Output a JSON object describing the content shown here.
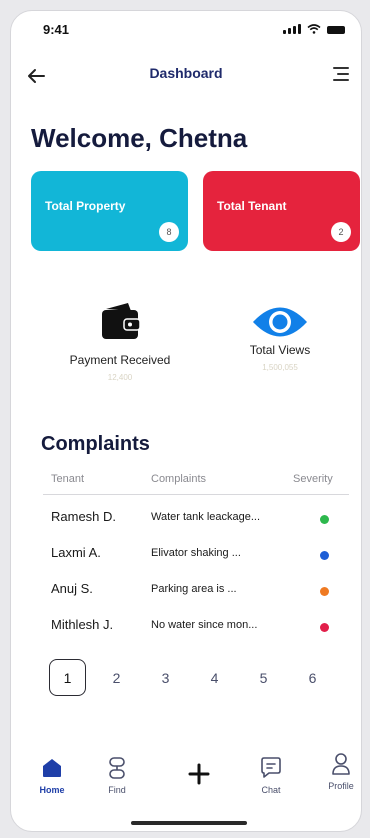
{
  "status_bar": {
    "time": "9:41"
  },
  "header": {
    "title": "Dashboard"
  },
  "welcome": "Welcome, Chetna",
  "cards": {
    "property": {
      "label": "Total Property",
      "count": "8",
      "color": "#12b6d7"
    },
    "tenant": {
      "label": "Total Tenant",
      "count": "2",
      "color": "#e5233d"
    }
  },
  "stats": {
    "payment": {
      "label": "Payment Received",
      "value": "12,400"
    },
    "views": {
      "label": "Total Views",
      "value": "1,500,055"
    }
  },
  "complaints": {
    "title": "Complaints",
    "columns": [
      "Tenant",
      "Complaints",
      "Severity"
    ],
    "rows": [
      {
        "tenant": "Ramesh D.",
        "complaint": "Water tank leackage...",
        "severity_color": "#2db84d"
      },
      {
        "tenant": "Laxmi A.",
        "complaint": "Elivator shaking ...",
        "severity_color": "#1f5fd6"
      },
      {
        "tenant": "Anuj S.",
        "complaint": "Parking area is ...",
        "severity_color": "#ef7a22"
      },
      {
        "tenant": "Mithlesh J.",
        "complaint": "No water since mon...",
        "severity_color": "#e21f4a"
      }
    ]
  },
  "pagination": {
    "pages": [
      "1",
      "2",
      "3",
      "4",
      "5",
      "6"
    ],
    "active": "1"
  },
  "nav": {
    "items": [
      "Home",
      "Find",
      "",
      "Chat",
      "Profile"
    ],
    "active": "Home",
    "accent": "#1f3fa8"
  }
}
